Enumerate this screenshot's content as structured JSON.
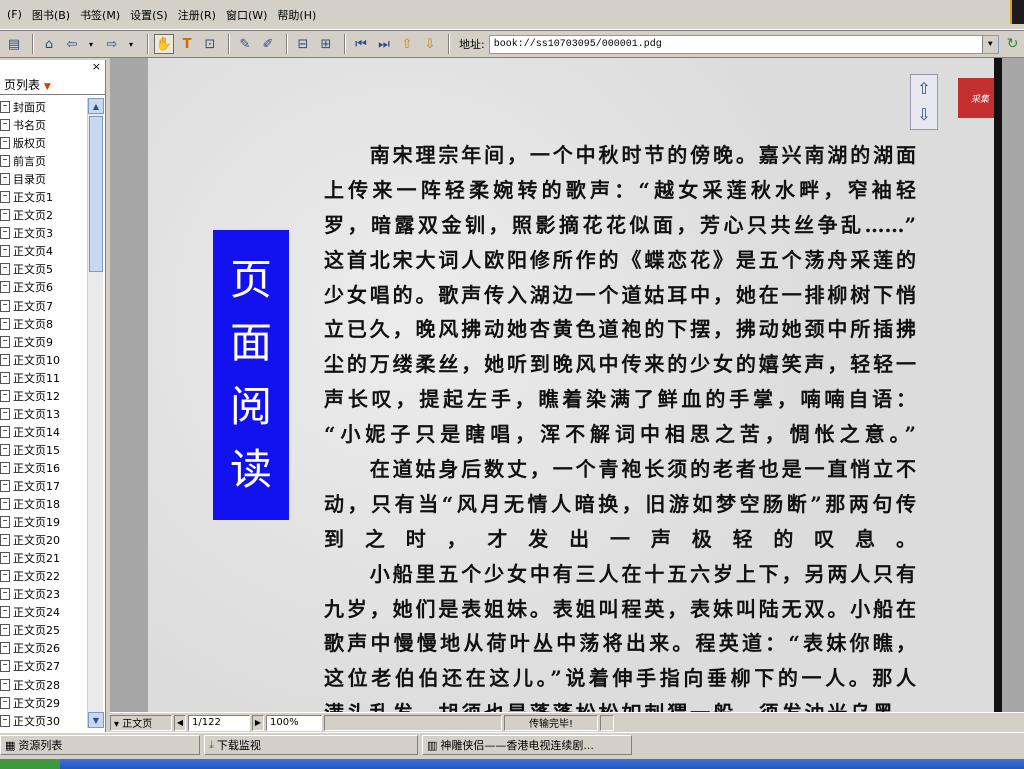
{
  "menu": [
    "(F)",
    "图书(B)",
    "书签(M)",
    "设置(S)",
    "注册(R)",
    "窗口(W)",
    "帮助(H)"
  ],
  "toolbar": {
    "address_label": "地址:",
    "address_value": "book://ss10703095/000001.pdg"
  },
  "left_panel": {
    "title": "页列表",
    "close": "×",
    "pages": [
      "封面页",
      "书名页",
      "版权页",
      "前言页",
      "目录页",
      "正文页1",
      "正文页2",
      "正文页3",
      "正文页4",
      "正文页5",
      "正文页6",
      "正文页7",
      "正文页8",
      "正文页9",
      "正文页10",
      "正文页11",
      "正文页12",
      "正文页13",
      "正文页14",
      "正文页15",
      "正文页16",
      "正文页17",
      "正文页18",
      "正文页19",
      "正文页20",
      "正文页21",
      "正文页22",
      "正文页23",
      "正文页24",
      "正文页25",
      "正文页26",
      "正文页27",
      "正文页28",
      "正文页29",
      "正文页30"
    ]
  },
  "viewer": {
    "banner": [
      "页",
      "面",
      "阅",
      "读"
    ],
    "stamp_text": "采集",
    "lines": [
      "　　南宋理宗年间，一个中秋时节的傍晚。嘉兴南湖的湖面",
      "上传来一阵轻柔婉转的歌声：“越女采莲秋水畔，窄袖轻",
      "罗，暗露双金钏，照影摘花花似面，芳心只共丝争乱……”",
      "这首北宋大词人欧阳修所作的《蝶恋花》是五个荡舟采莲的",
      "少女唱的。歌声传入湖边一个道姑耳中，她在一排柳树下悄",
      "立已久，晚风拂动她杏黄色道袍的下摆，拂动她颈中所插拂",
      "尘的万缕柔丝，她听到晚风中传来的少女的嬉笑声，轻轻一",
      "声长叹，提起左手，瞧着染满了鲜血的手掌，喃喃自语：",
      "“小妮子只是瞎唱，浑不解词中相思之苦，惆怅之意。”",
      "　　在道姑身后数丈，一个青袍长须的老者也是一直悄立不",
      "动，只有当“风月无情人暗换，旧游如梦空肠断”那两句传",
      "到之时，才发出一声极轻的叹息。",
      "　　小船里五个少女中有三人在十五六岁上下，另两人只有",
      "九岁，她们是表姐妹。表姐叫程英，表妹叫陆无双。小船在",
      "歌声中慢慢地从荷叶丛中荡将出来。程英道：“表妹你瞧，",
      "这位老伯伯还在这儿。”说着伸手指向垂柳下的一人。那人",
      "满头乱发，胡须也是蓬蓬松松如刺猬一般，须发油光乌黑。"
    ]
  },
  "status": {
    "mode": "▾ 正文页",
    "page": "1/122",
    "zoom": "100%",
    "message": "传输完毕!"
  },
  "taskbar": {
    "tasks": [
      "资源列表",
      "下载监视",
      "神雕侠侣——香港电视连续剧..."
    ]
  }
}
